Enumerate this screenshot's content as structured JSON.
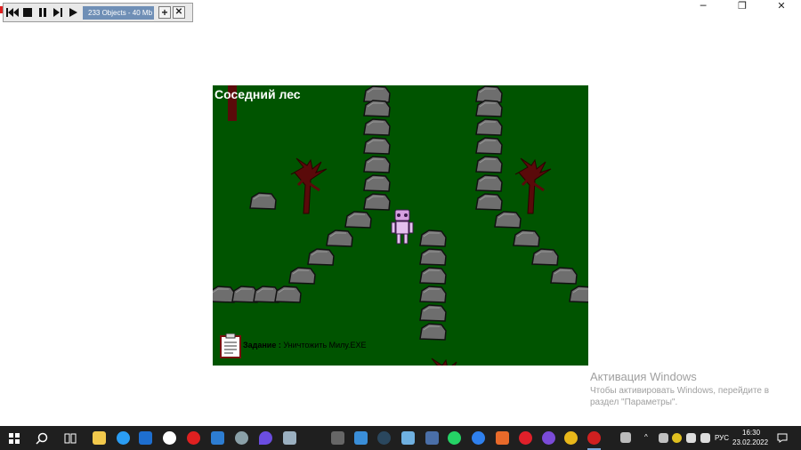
{
  "window_controls": {
    "minimize": "─",
    "maximize": "❐",
    "close": "✕"
  },
  "debugger": {
    "buttons": [
      "restart-icon",
      "stop-icon",
      "pause-icon",
      "step-icon",
      "play-icon"
    ],
    "status": "233 Objects - 40 Mb",
    "add": "+",
    "close": "✕"
  },
  "game": {
    "location_title": "Соседний лес",
    "quest_label": "Задание :",
    "quest_text": "Уничтожить Милу.EXE",
    "colors": {
      "grass": "#005400",
      "tree": "#5a0a0a",
      "stone": "#6e6e6e"
    }
  },
  "watermark": {
    "title": "Активация Windows",
    "line1": "Чтобы активировать Windows, перейдите в",
    "line2": "раздел \"Параметры\"."
  },
  "taskbar": {
    "tray_lang": "РУС",
    "time": "16:30",
    "date": "23.02.2022"
  }
}
